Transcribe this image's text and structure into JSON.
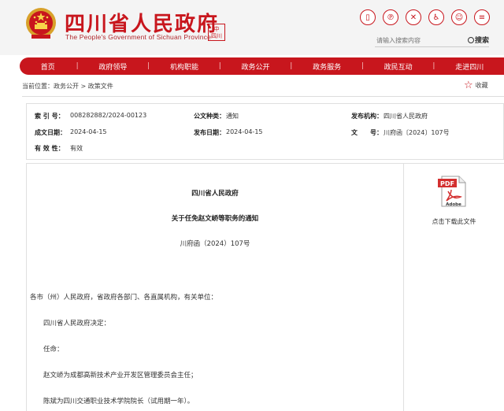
{
  "header": {
    "title": "四川省人民政府",
    "subtitle": "The People's Government of Sichuan Province",
    "seal_chars": [
      "中",
      "国",
      "四川"
    ],
    "search_placeholder": "请输入搜索内容",
    "search_label": "搜索",
    "icons": [
      "mobile-icon",
      "weibo-icon",
      "accessibility-icon",
      "wheelchair-icon",
      "elder-care-icon",
      "more-icon"
    ],
    "accent": "#c8161d"
  },
  "nav": {
    "items": [
      "首页",
      "政府领导",
      "机构职能",
      "政务公开",
      "政务服务",
      "政民互动",
      "走进四川"
    ]
  },
  "breadcrumb": "当前位置：政务公开 > 政策文件",
  "favorite_label": "收藏",
  "meta": {
    "index_label": "索 引 号：",
    "index_value": "008282882/2024-00123",
    "type_label": "公文种类：",
    "type_value": "通知",
    "issuer_label": "发布机构：",
    "issuer_value": "四川省人民政府",
    "date_label": "成文日期：",
    "date_value": "2024-04-15",
    "pub_label": "发布日期：",
    "pub_value": "2024-04-15",
    "docno_label": "文　　号：",
    "docno_value": "川府函〔2024〕107号",
    "valid_label": "有 效 性：",
    "valid_value": "有效"
  },
  "document": {
    "org": "四川省人民政府",
    "title": "关于任免赵文峤等职务的通知",
    "number": "川府函（2024）107号",
    "paragraphs": [
      "各市（州）人民政府，省政府各部门、各直属机构，有关单位：",
      "四川省人民政府决定：",
      "任命：",
      "赵文峤为成都高新技术产业开发区管理委员会主任；",
      "陈斌为四川交通职业技术学院院长（试用期一年）。"
    ]
  },
  "sidebar": {
    "pdf_text": "PDF",
    "adobe_text": "Adobe",
    "download_label": "点击下载此文件"
  }
}
